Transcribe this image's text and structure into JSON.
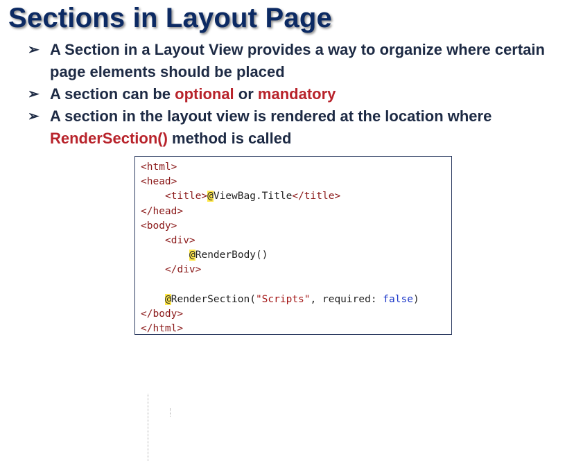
{
  "title": "Sections in Layout Page",
  "bullets": [
    {
      "text": "A Section in a Layout View provides a way to organize where certain page elements should be placed"
    },
    {
      "before": "A section can be ",
      "hl1": "optional",
      "middle": " or ",
      "hl2": "mandatory"
    },
    {
      "before": "A section in the layout view is rendered at the location where ",
      "hl": "RenderSection()",
      "after": " method is called"
    }
  ],
  "code": {
    "html_open": "<html>",
    "head_open": "<head>",
    "title_open": "<title>",
    "at": "@",
    "viewbag": "ViewBag.Title",
    "title_close": "</title>",
    "head_close": "</head>",
    "body_open": "<body>",
    "div_open": "<div>",
    "render_body": "RenderBody()",
    "div_close": "</div>",
    "render_section": "RenderSection(",
    "scripts_string": "\"Scripts\"",
    "required_label": ", required: ",
    "false_kw": "false",
    "paren_close": ")",
    "body_close": "</body>",
    "html_close": "</html>"
  },
  "colors": {
    "title": "#0c2a63",
    "highlight": "#b8232b",
    "code_tag": "#8b1a1a",
    "code_string": "#a31515",
    "code_keyword": "#1a36c8",
    "razor_marker": "#ffe84a"
  },
  "icons": {
    "bullet": "arrow-bullet-icon"
  }
}
